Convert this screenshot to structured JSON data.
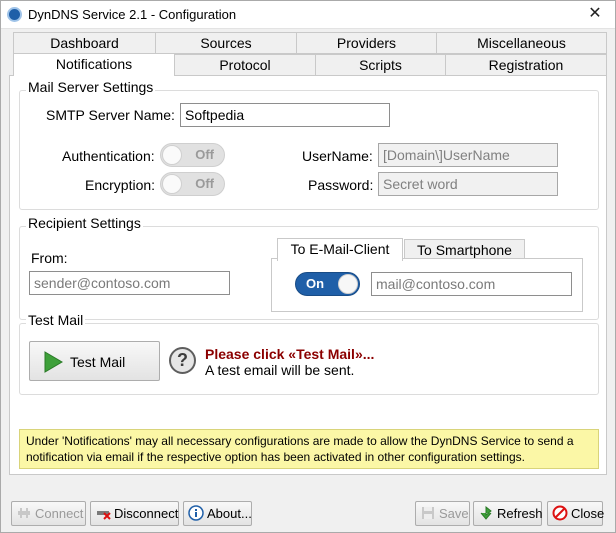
{
  "window": {
    "title": "DynDNS Service 2.1 - Configuration",
    "close_glyph": "✕"
  },
  "tabs": {
    "row1": [
      "Dashboard",
      "Sources",
      "Providers",
      "Miscellaneous"
    ],
    "row2": [
      "Notifications",
      "Protocol",
      "Scripts",
      "Registration"
    ],
    "active": "Notifications"
  },
  "mail_server": {
    "title": "Mail Server Settings",
    "smtp_label": "SMTP Server Name:",
    "smtp_value": "Softpedia",
    "auth_label": "Authentication:",
    "auth_state": "Off",
    "enc_label": "Encryption:",
    "enc_state": "Off",
    "username_label": "UserName:",
    "username_placeholder": "[Domain\\]UserName",
    "password_label": "Password:",
    "password_placeholder": "Secret word"
  },
  "recipient": {
    "title": "Recipient Settings",
    "from_label": "From:",
    "from_placeholder": "sender@contoso.com",
    "subtabs": [
      "To E-Mail-Client",
      "To Smartphone"
    ],
    "toggle_state": "On",
    "to_placeholder": "mail@contoso.com"
  },
  "test_mail": {
    "title": "Test Mail",
    "button_label": "Test Mail",
    "help_glyph": "?",
    "headline": "Please click «Test Mail»...",
    "subline": "A test email will be sent."
  },
  "info_text": "Under 'Notifications' may all necessary configurations are made to allow the DynDNS Service to send a notification via email if the respective option has been activated in other configuration settings.",
  "footer": {
    "connect": "Connect",
    "disconnect": "Disconnect",
    "about": "About...",
    "save": "Save",
    "refresh": "Refresh",
    "close": "Close"
  },
  "colors": {
    "accent": "#1f5fa8",
    "headline": "#8b0000",
    "info_bg": "#fbf7a6"
  }
}
